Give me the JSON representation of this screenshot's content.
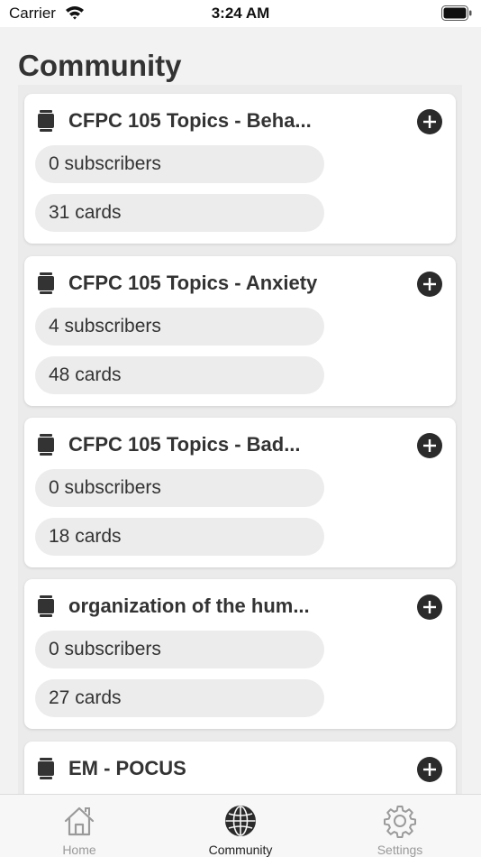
{
  "status_bar": {
    "carrier": "Carrier",
    "time": "3:24 AM"
  },
  "page": {
    "title": "Community"
  },
  "decks": [
    {
      "title": "CFPC 105 Topics - Beha...",
      "subscribers": "0 subscribers",
      "cards": "31 cards"
    },
    {
      "title": "CFPC 105 Topics - Anxiety",
      "subscribers": "4 subscribers",
      "cards": "48 cards"
    },
    {
      "title": "CFPC 105 Topics - Bad...",
      "subscribers": "0 subscribers",
      "cards": "18 cards"
    },
    {
      "title": "organization of the hum...",
      "subscribers": "0 subscribers",
      "cards": "27 cards"
    },
    {
      "title": "EM - POCUS",
      "subscribers": "",
      "cards": ""
    }
  ],
  "tabs": [
    {
      "label": "Home",
      "icon": "house-icon",
      "active": false
    },
    {
      "label": "Community",
      "icon": "globe-icon",
      "active": true
    },
    {
      "label": "Settings",
      "icon": "gear-icon",
      "active": false
    }
  ],
  "colors": {
    "background": "#f2f2f2",
    "card": "#ffffff",
    "pill": "#ececec",
    "accent_dark": "#2b2b2b",
    "tab_inactive": "#9a9a9a"
  }
}
